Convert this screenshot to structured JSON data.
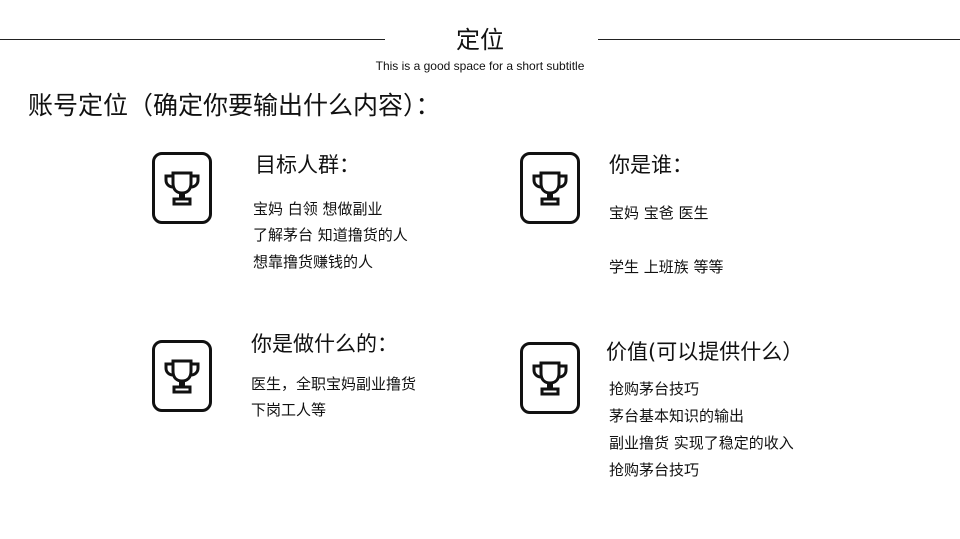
{
  "slide": {
    "title": "定位",
    "subtitle": "This is a good space for a short subtitle",
    "heading": "账号定位（确定你要输出什么内容）："
  },
  "blocks": [
    {
      "icon": "trophy-icon",
      "title": "目标人群：",
      "lines": [
        "宝妈  白领   想做副业",
        " 了解茅台   知道撸货的人",
        "想靠撸货赚钱的人"
      ]
    },
    {
      "icon": "trophy-icon",
      "title": "你是谁：",
      "lines": [
        "宝妈  宝爸 医生",
        "学生  上班族  等等"
      ]
    },
    {
      "icon": "trophy-icon",
      "title": "你是做什么的：",
      "lines": [
        "医生，全职宝妈副业撸货",
        "下岗工人等"
      ]
    },
    {
      "icon": "trophy-icon",
      "title": "价值(可以提供什么）",
      "lines": [
        "抢购茅台技巧",
        "茅台基本知识的输出",
        "副业撸货  实现了稳定的收入",
        "抢购茅台技巧"
      ]
    }
  ]
}
